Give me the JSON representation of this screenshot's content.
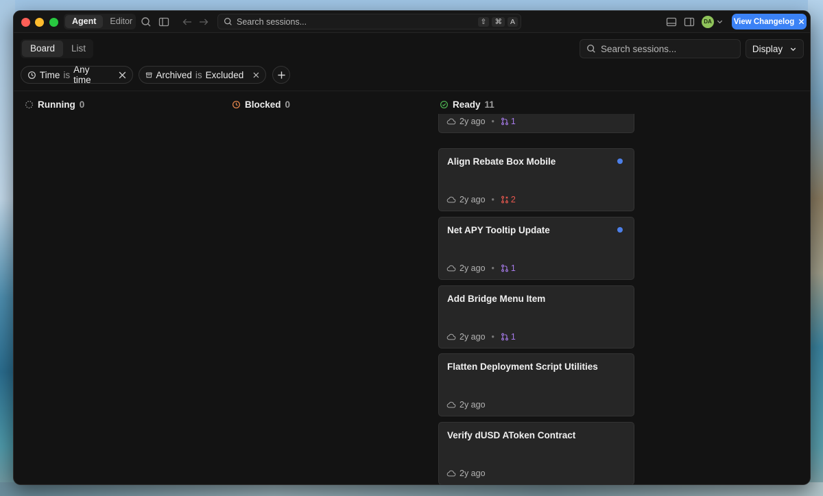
{
  "titlebar": {
    "modes": [
      "Agent",
      "Editor"
    ],
    "active_mode": "Agent",
    "search_placeholder": "Search sessions...",
    "shortcut_keys": [
      "⇧",
      "⌘",
      "A"
    ],
    "avatar_initials": "DA",
    "changelog_label": "View Changelog"
  },
  "toolbar": {
    "views": [
      "Board",
      "List"
    ],
    "active_view": "Board",
    "search_placeholder": "Search sessions...",
    "display_label": "Display"
  },
  "filters": [
    {
      "field": "Time",
      "op": "is",
      "value": "Any time"
    },
    {
      "field": "Archived",
      "op": "is",
      "value": "Excluded"
    }
  ],
  "columns": [
    {
      "name": "Running",
      "count": "0",
      "color": "#9a9a9a"
    },
    {
      "name": "Blocked",
      "count": "0",
      "color": "#e0834a"
    },
    {
      "name": "Ready",
      "count": "11",
      "color": "#4caf50"
    }
  ],
  "cards": [
    {
      "title": "",
      "time": "2y ago",
      "pr_count": "1",
      "pr_state": "open",
      "unread": false,
      "partial": true
    },
    {
      "title": "Align Rebate Box Mobile",
      "time": "2y ago",
      "pr_count": "2",
      "pr_state": "closed",
      "unread": true
    },
    {
      "title": "Net APY Tooltip Update",
      "time": "2y ago",
      "pr_count": "1",
      "pr_state": "open",
      "unread": true
    },
    {
      "title": "Add Bridge Menu Item",
      "time": "2y ago",
      "pr_count": "1",
      "pr_state": "open",
      "unread": false
    },
    {
      "title": "Flatten Deployment Script Utilities",
      "time": "2y ago",
      "pr_count": "",
      "pr_state": "",
      "unread": false
    },
    {
      "title": "Verify dUSD AToken Contract",
      "time": "2y ago",
      "pr_count": "",
      "pr_state": "",
      "unread": false
    }
  ]
}
